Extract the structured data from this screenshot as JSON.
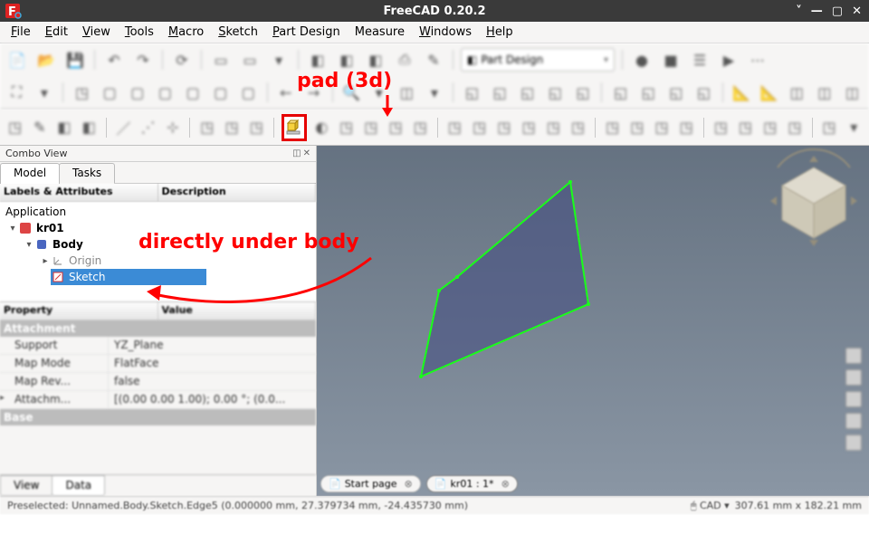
{
  "window": {
    "title": "FreeCAD 0.20.2",
    "controls": {
      "min": "—",
      "max": "▢",
      "close": "✕"
    }
  },
  "menu": [
    "File",
    "Edit",
    "View",
    "Tools",
    "Macro",
    "Sketch",
    "Part Design",
    "Measure",
    "Windows",
    "Help"
  ],
  "workbench_selector": "Part Design",
  "toolbar_row3": {
    "pad_tooltip": "Pad"
  },
  "combo": {
    "title": "Combo View",
    "tabs": [
      "Model",
      "Tasks"
    ],
    "active_tab": 0,
    "tree_headers": [
      "Labels & Attributes",
      "Description"
    ],
    "tree": {
      "root": "Application",
      "doc": "kr01",
      "body": "Body",
      "origin": "Origin",
      "sketch": "Sketch"
    },
    "prop_headers": [
      "Property",
      "Value"
    ],
    "prop_categories": [
      {
        "name": "Attachment",
        "rows": [
          {
            "k": "Support",
            "v": "YZ_Plane"
          },
          {
            "k": "Map Mode",
            "v": "FlatFace"
          },
          {
            "k": "Map Rev...",
            "v": "false"
          },
          {
            "k": "Attachm...",
            "v": "[(0.00 0.00 1.00); 0.00 °; (0.0..."
          }
        ]
      },
      {
        "name": "Base",
        "rows": []
      }
    ],
    "prop_tabs": [
      "View",
      "Data"
    ],
    "prop_active_tab": 1
  },
  "view3d": {
    "tabs": [
      {
        "label": "Start page",
        "active": false
      },
      {
        "label": "kr01 : 1*",
        "active": true
      }
    ]
  },
  "statusbar": {
    "left": "Preselected: Unnamed.Body.Sketch.Edge5 (0.000000 mm, 27.379734 mm, -24.435730 mm)",
    "nav": "CAD",
    "dims": "307.61 mm x 182.21 mm"
  },
  "annotations": {
    "pad": "pad (3d)",
    "body": "directly under body"
  }
}
